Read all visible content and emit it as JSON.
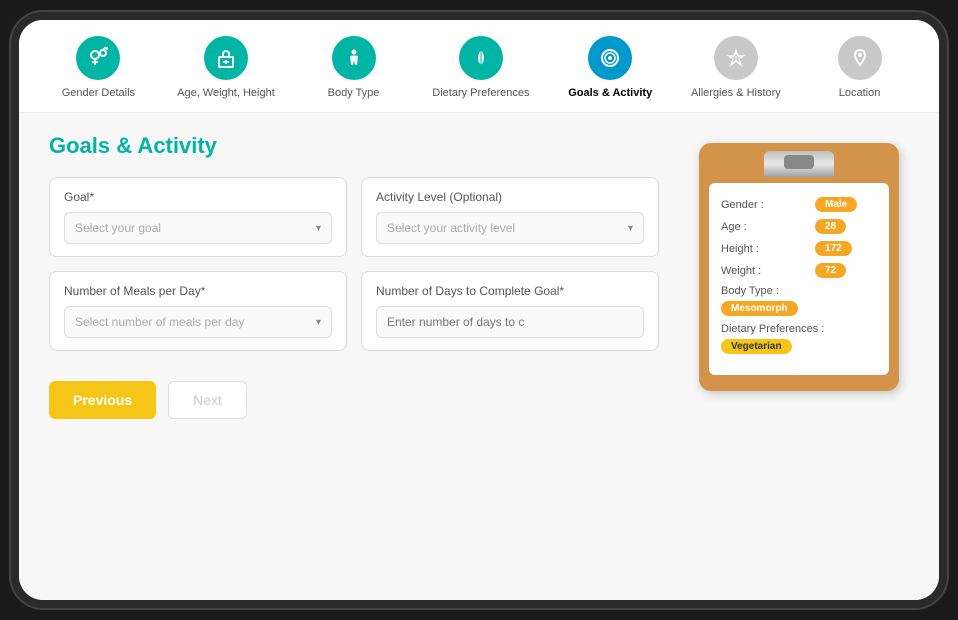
{
  "stepper": {
    "steps": [
      {
        "id": "gender",
        "icon": "⚤",
        "label": "Gender\nDetails",
        "state": "teal"
      },
      {
        "id": "age-weight",
        "icon": "↕",
        "label": "Age, Weight,\nHeight",
        "state": "teal"
      },
      {
        "id": "body-type",
        "icon": "◎",
        "label": "Body\nType",
        "state": "teal"
      },
      {
        "id": "dietary",
        "icon": "🌿",
        "label": "Dietary\nPreferences",
        "state": "teal"
      },
      {
        "id": "goals",
        "icon": "◎",
        "label": "Goals &\nActivity",
        "state": "active-blue",
        "active": true
      },
      {
        "id": "allergies",
        "icon": "♥",
        "label": "Allergies &\nHistory",
        "state": "gray"
      },
      {
        "id": "location",
        "icon": "📍",
        "label": "Location",
        "state": "gray"
      }
    ]
  },
  "form": {
    "title": "Goals & Activity",
    "fields": [
      {
        "id": "goal",
        "label": "Goal*",
        "type": "select",
        "placeholder": "Select your goal"
      },
      {
        "id": "activity-level",
        "label": "Activity Level (Optional)",
        "type": "select",
        "placeholder": "Select your activity level"
      },
      {
        "id": "meals-per-day",
        "label": "Number of Meals per Day*",
        "type": "select",
        "placeholder": "Select number of meals per day"
      },
      {
        "id": "days-to-complete",
        "label": "Number of Days to Complete Goal*",
        "type": "input",
        "placeholder": "Enter number of days to c"
      }
    ],
    "buttons": {
      "previous": "Previous",
      "next": "Next"
    }
  },
  "clipboard": {
    "rows": [
      {
        "key": "Gender :",
        "value": "Male",
        "tag": "orange"
      },
      {
        "key": "Age :",
        "value": "28",
        "tag": "orange"
      },
      {
        "key": "Height :",
        "value": "172",
        "tag": "orange"
      },
      {
        "key": "Weight :",
        "value": "72",
        "tag": "orange"
      },
      {
        "key": "Body Type :",
        "value": "Mesomorph",
        "tag": "orange"
      },
      {
        "key": "Dietary Preferences :",
        "value": "Vegetarian",
        "tag": "yellow"
      }
    ]
  }
}
